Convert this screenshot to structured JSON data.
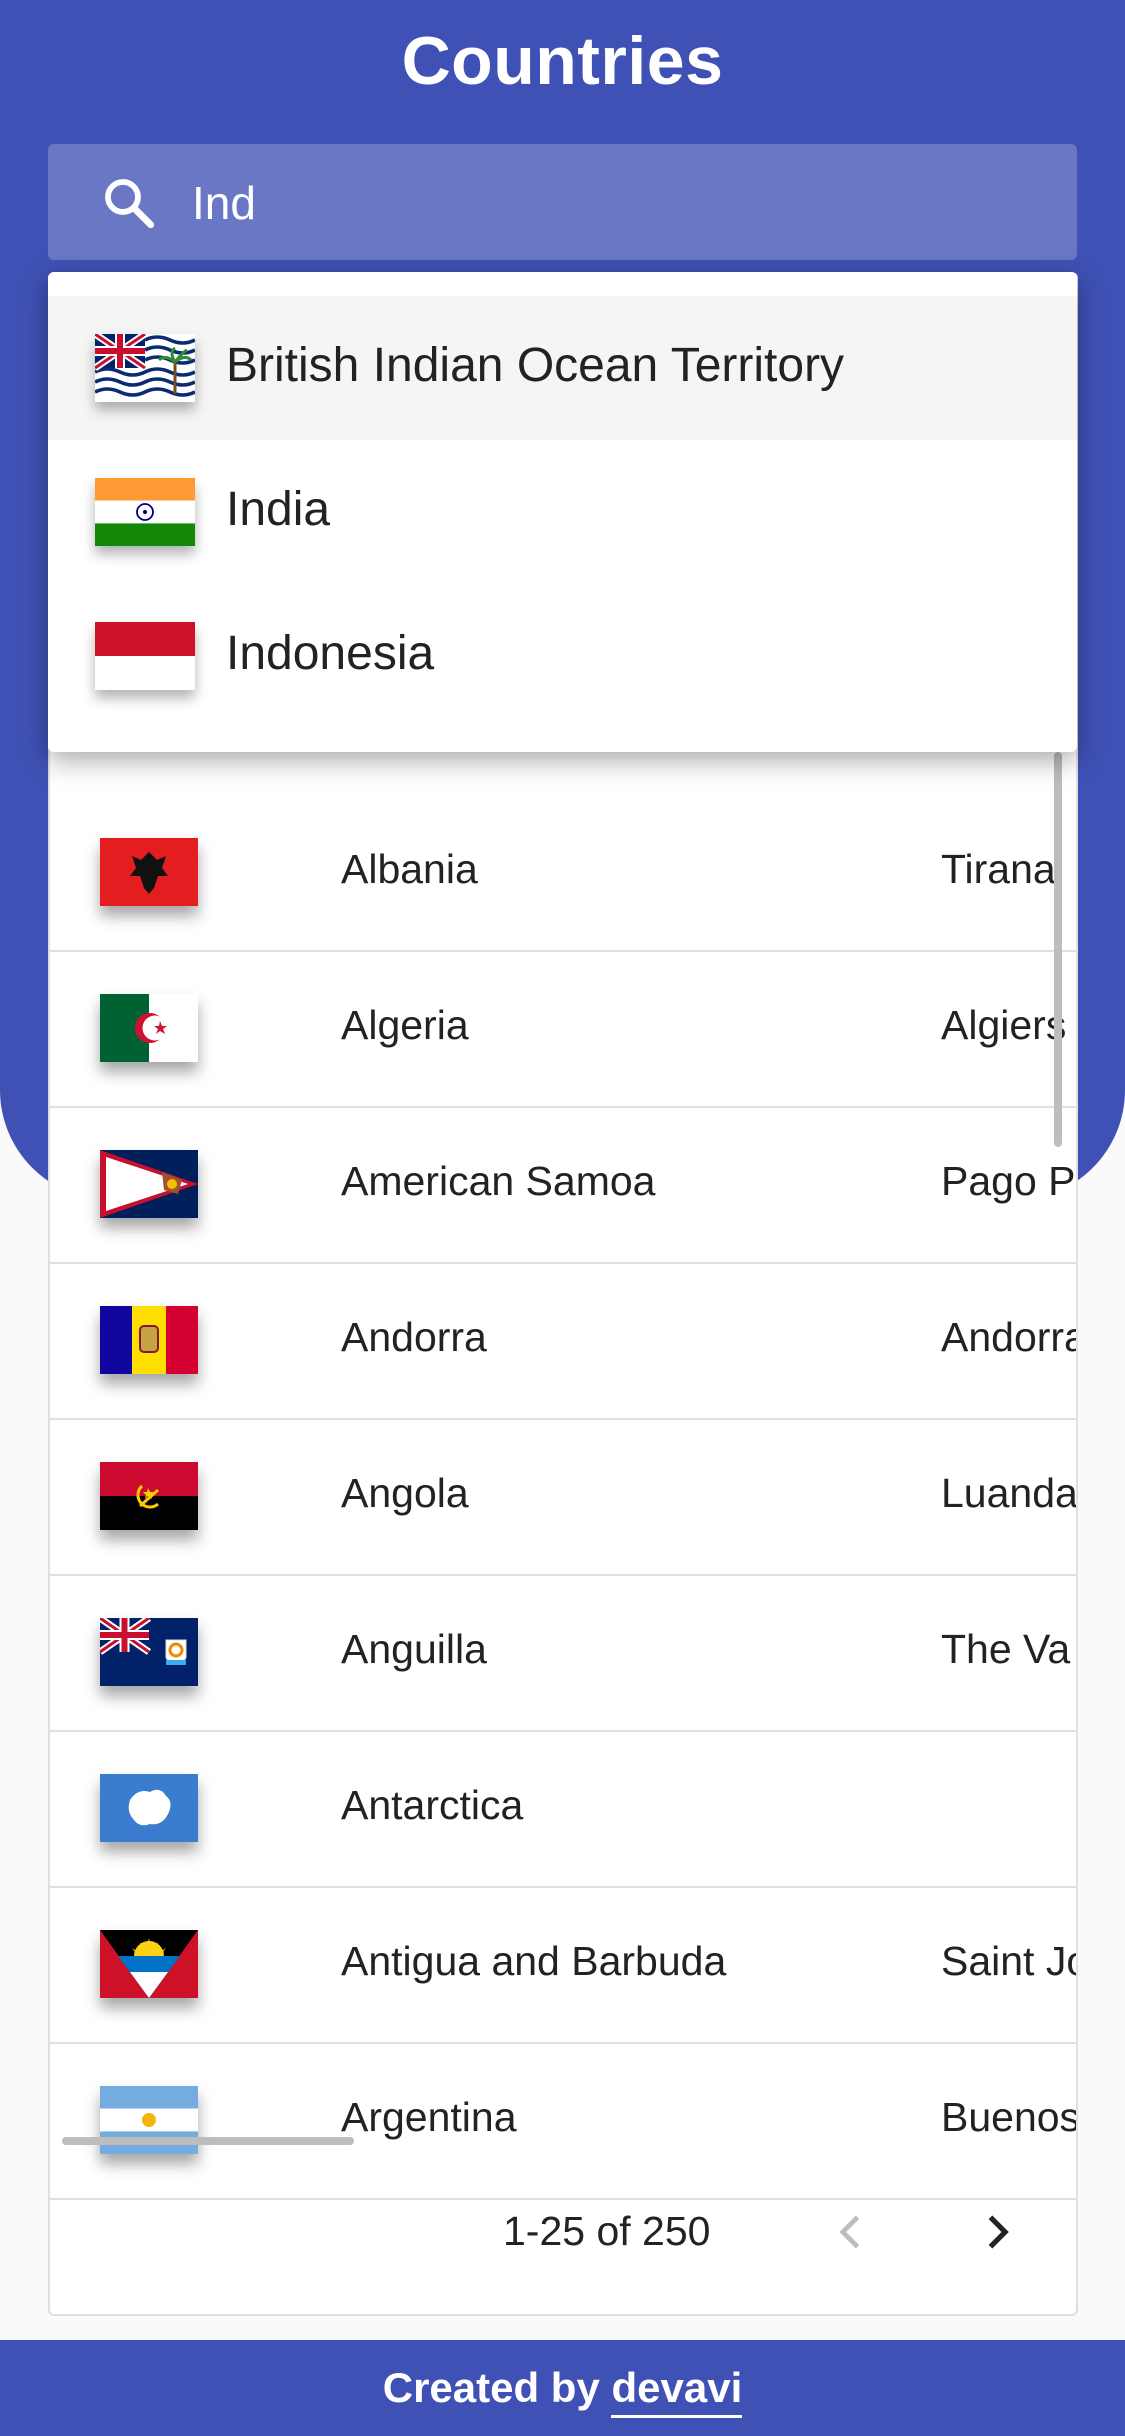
{
  "header": {
    "title": "Countries"
  },
  "search": {
    "query": "Ind"
  },
  "suggestions": [
    {
      "label": "British Indian Ocean Territory",
      "flag": "io"
    },
    {
      "label": "India",
      "flag": "in"
    },
    {
      "label": "Indonesia",
      "flag": "id"
    }
  ],
  "table": {
    "rows": [
      {
        "name": "Albania",
        "capital": "Tirana",
        "flag": "al"
      },
      {
        "name": "Algeria",
        "capital": "Algiers",
        "flag": "dz"
      },
      {
        "name": "American Samoa",
        "capital": "Pago P",
        "flag": "as"
      },
      {
        "name": "Andorra",
        "capital": "Andorra",
        "flag": "ad"
      },
      {
        "name": "Angola",
        "capital": "Luanda",
        "flag": "ao"
      },
      {
        "name": "Anguilla",
        "capital": "The Va",
        "flag": "ai"
      },
      {
        "name": "Antarctica",
        "capital": "",
        "flag": "aq"
      },
      {
        "name": "Antigua and Barbuda",
        "capital": "Saint Jo",
        "flag": "ag"
      },
      {
        "name": "Argentina",
        "capital": "Buenos",
        "flag": "ar"
      }
    ]
  },
  "pagination": {
    "range": "1-25 of 250"
  },
  "footer": {
    "prefix": "Created by ",
    "link": "devavi"
  },
  "colors": {
    "primary": "#3f51b5"
  }
}
